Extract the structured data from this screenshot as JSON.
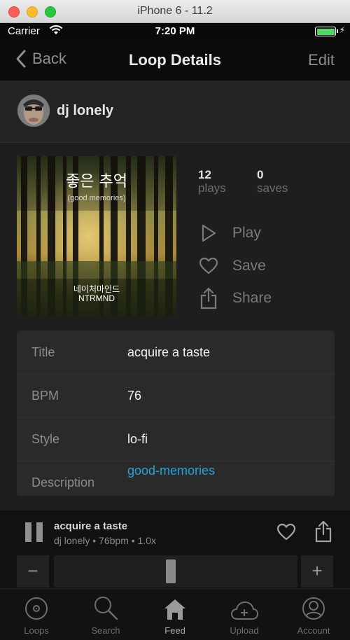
{
  "window": {
    "title": "iPhone 6 - 11.2"
  },
  "status": {
    "carrier": "Carrier",
    "time": "7:20 PM"
  },
  "nav": {
    "back": "Back",
    "title": "Loop Details",
    "edit": "Edit"
  },
  "user": {
    "name": "dj lonely"
  },
  "artwork": {
    "title": "좋은 추억",
    "subtitle": "(good memories)",
    "artist_line1": "네이처마인드",
    "artist_line2": "NTRMND"
  },
  "stats": {
    "plays": "12",
    "plays_label": "plays",
    "saves": "0",
    "saves_label": "saves"
  },
  "actions": {
    "play": "Play",
    "save": "Save",
    "share": "Share"
  },
  "details": [
    {
      "label": "Title",
      "value": "acquire a taste"
    },
    {
      "label": "BPM",
      "value": "76"
    },
    {
      "label": "Style",
      "value": "lo-fi"
    },
    {
      "label": "Description",
      "value": "good-memories"
    }
  ],
  "player": {
    "title": "acquire a taste",
    "meta": "dj lonely • 76bpm • 1.0x",
    "minus": "−",
    "plus": "+",
    "slider_position": 0.48
  },
  "tabs": [
    {
      "label": "Loops",
      "icon": "record-icon"
    },
    {
      "label": "Search",
      "icon": "search-icon"
    },
    {
      "label": "Feed",
      "icon": "home-icon"
    },
    {
      "label": "Upload",
      "icon": "cloud-upload-icon"
    },
    {
      "label": "Account",
      "icon": "account-icon"
    }
  ],
  "colors": {
    "accent_link": "#24a3d8",
    "battery": "#4cd964"
  }
}
